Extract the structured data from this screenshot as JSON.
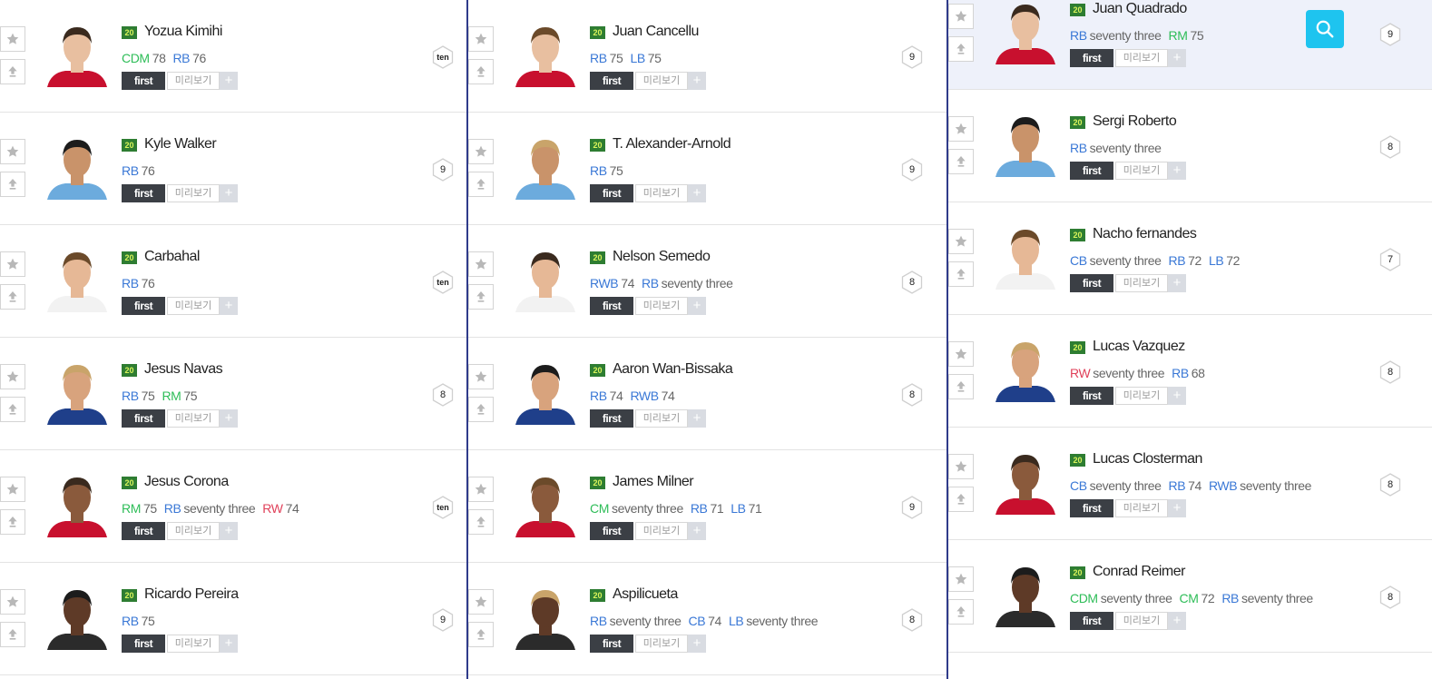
{
  "labels": {
    "first": "first",
    "preview": "미리보기",
    "plus": "+"
  },
  "colors": {
    "green": "#2ebd58",
    "blue": "#3a78d6",
    "red": "#e0415a",
    "divider": "#2f3b8a",
    "search": "#1ec4ef",
    "season": "#2e7d32"
  },
  "search": {
    "icon": "search-icon"
  },
  "columns": [
    {
      "players": [
        {
          "season": "20",
          "name": "Yozua Kimihi",
          "ovr": "ten",
          "highlight": false,
          "positions": [
            {
              "code": "CDM",
              "rating": "78",
              "color": "green"
            },
            {
              "code": "RB",
              "rating": "76",
              "color": "blue"
            }
          ]
        },
        {
          "season": "20",
          "name": "Kyle Walker",
          "ovr": "9",
          "highlight": false,
          "positions": [
            {
              "code": "RB",
              "rating": "76",
              "color": "blue"
            }
          ]
        },
        {
          "season": "20",
          "name": "Carbahal",
          "ovr": "ten",
          "highlight": false,
          "positions": [
            {
              "code": "RB",
              "rating": "76",
              "color": "blue"
            }
          ]
        },
        {
          "season": "20",
          "name": "Jesus Navas",
          "ovr": "8",
          "highlight": false,
          "positions": [
            {
              "code": "RB",
              "rating": "75",
              "color": "blue"
            },
            {
              "code": "RM",
              "rating": "75",
              "color": "green"
            }
          ]
        },
        {
          "season": "20",
          "name": "Jesus Corona",
          "ovr": "ten",
          "highlight": false,
          "positions": [
            {
              "code": "RM",
              "rating": "75",
              "color": "green"
            },
            {
              "code": "RB",
              "rating": "seventy three",
              "color": "blue"
            },
            {
              "code": "RW",
              "rating": "74",
              "color": "red"
            }
          ]
        },
        {
          "season": "20",
          "name": "Ricardo Pereira",
          "ovr": "9",
          "highlight": false,
          "positions": [
            {
              "code": "RB",
              "rating": "75",
              "color": "blue"
            }
          ]
        }
      ]
    },
    {
      "players": [
        {
          "season": "20",
          "name": "Juan Cancellu",
          "ovr": "9",
          "highlight": false,
          "positions": [
            {
              "code": "RB",
              "rating": "75",
              "color": "blue"
            },
            {
              "code": "LB",
              "rating": "75",
              "color": "blue"
            }
          ]
        },
        {
          "season": "20",
          "name": "T. Alexander-Arnold",
          "ovr": "9",
          "highlight": false,
          "positions": [
            {
              "code": "RB",
              "rating": "75",
              "color": "blue"
            }
          ]
        },
        {
          "season": "20",
          "name": "Nelson Semedo",
          "ovr": "8",
          "highlight": false,
          "positions": [
            {
              "code": "RWB",
              "rating": "74",
              "color": "blue"
            },
            {
              "code": "RB",
              "rating": "seventy three",
              "color": "blue"
            }
          ]
        },
        {
          "season": "20",
          "name": "Aaron Wan-Bissaka",
          "ovr": "8",
          "highlight": false,
          "positions": [
            {
              "code": "RB",
              "rating": "74",
              "color": "blue"
            },
            {
              "code": "RWB",
              "rating": "74",
              "color": "blue"
            }
          ]
        },
        {
          "season": "20",
          "name": "James Milner",
          "ovr": "9",
          "highlight": false,
          "positions": [
            {
              "code": "CM",
              "rating": "seventy three",
              "color": "green"
            },
            {
              "code": "RB",
              "rating": "71",
              "color": "blue"
            },
            {
              "code": "LB",
              "rating": "71",
              "color": "blue"
            }
          ]
        },
        {
          "season": "20",
          "name": "Aspilicueta",
          "ovr": "8",
          "highlight": false,
          "positions": [
            {
              "code": "RB",
              "rating": "seventy three",
              "color": "blue"
            },
            {
              "code": "CB",
              "rating": "74",
              "color": "blue"
            },
            {
              "code": "LB",
              "rating": "seventy three",
              "color": "blue"
            }
          ]
        }
      ]
    },
    {
      "players": [
        {
          "season": "20",
          "name": "Juan Quadrado",
          "ovr": "9",
          "highlight": true,
          "positions": [
            {
              "code": "RB",
              "rating": "seventy three",
              "color": "blue"
            },
            {
              "code": "RM",
              "rating": "75",
              "color": "green"
            }
          ]
        },
        {
          "season": "20",
          "name": "Sergi Roberto",
          "ovr": "8",
          "highlight": false,
          "positions": [
            {
              "code": "RB",
              "rating": "seventy three",
              "color": "blue"
            }
          ]
        },
        {
          "season": "20",
          "name": "Nacho fernandes",
          "ovr": "7",
          "highlight": false,
          "positions": [
            {
              "code": "CB",
              "rating": "seventy three",
              "color": "blue"
            },
            {
              "code": "RB",
              "rating": "72",
              "color": "blue"
            },
            {
              "code": "LB",
              "rating": "72",
              "color": "blue"
            }
          ]
        },
        {
          "season": "20",
          "name": "Lucas Vazquez",
          "ovr": "8",
          "highlight": false,
          "positions": [
            {
              "code": "RW",
              "rating": "seventy three",
              "color": "red"
            },
            {
              "code": "RB",
              "rating": "68",
              "color": "blue"
            }
          ]
        },
        {
          "season": "20",
          "name": "Lucas Closterman",
          "ovr": "8",
          "highlight": false,
          "positions": [
            {
              "code": "CB",
              "rating": "seventy three",
              "color": "blue"
            },
            {
              "code": "RB",
              "rating": "74",
              "color": "blue"
            },
            {
              "code": "RWB",
              "rating": "seventy three",
              "color": "blue"
            }
          ]
        },
        {
          "season": "20",
          "name": "Conrad Reimer",
          "ovr": "8",
          "highlight": false,
          "positions": [
            {
              "code": "CDM",
              "rating": "seventy three",
              "color": "green"
            },
            {
              "code": "CM",
              "rating": "72",
              "color": "green"
            },
            {
              "code": "RB",
              "rating": "seventy three",
              "color": "blue"
            }
          ]
        }
      ]
    }
  ]
}
